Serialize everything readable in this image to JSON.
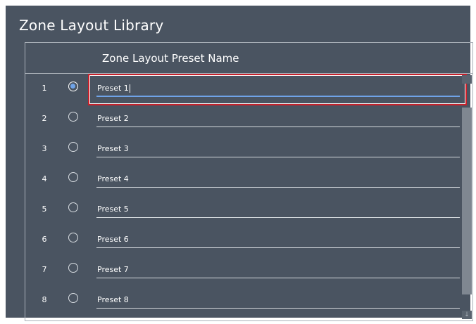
{
  "window": {
    "title": "Zone Layout Library"
  },
  "table": {
    "column_header": "Zone Layout Preset Name",
    "rows": [
      {
        "number": "1",
        "name": "Preset 1",
        "selected": true
      },
      {
        "number": "2",
        "name": "Preset 2",
        "selected": false
      },
      {
        "number": "3",
        "name": "Preset 3",
        "selected": false
      },
      {
        "number": "4",
        "name": "Preset 4",
        "selected": false
      },
      {
        "number": "5",
        "name": "Preset 5",
        "selected": false
      },
      {
        "number": "6",
        "name": "Preset 6",
        "selected": false
      },
      {
        "number": "7",
        "name": "Preset 7",
        "selected": false
      },
      {
        "number": "8",
        "name": "Preset 8",
        "selected": false
      }
    ]
  },
  "icons": {
    "scroll_up": "chevron-up-icon",
    "scroll_down": "chevron-down-icon",
    "scroll_down_glyph": "↓"
  },
  "colors": {
    "background": "#4a5461",
    "accent": "#6fa3e8",
    "focus_border": "#c8202a"
  }
}
